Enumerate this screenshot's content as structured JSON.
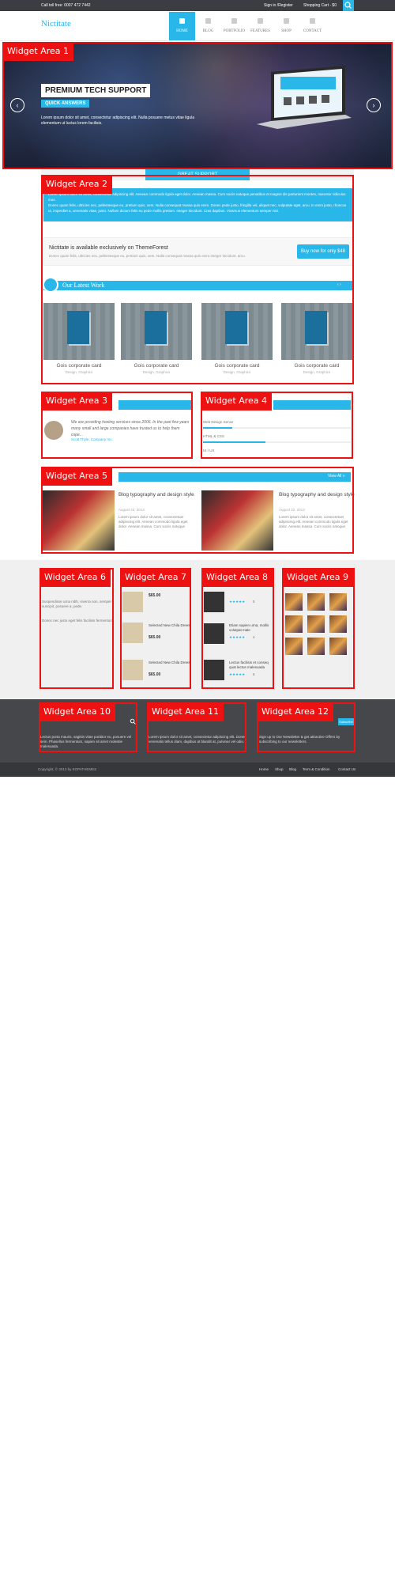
{
  "topbar": {
    "toll_free": "Call toll free: 0007 472 7442",
    "sign_in": "Sign in /Register",
    "cart": "Shopping Cart - $0"
  },
  "header": {
    "logo": "Nictitate",
    "nav": [
      "HOME",
      "BLOG",
      "PORTFOLIO",
      "FEATURES",
      "SHOP",
      "CONTACT"
    ]
  },
  "widgets": [
    "Widget Area 1",
    "Widget Area 2",
    "Widget Area 3",
    "Widget Area 4",
    "Widget Area 5",
    "Widget Area 6",
    "Widget Area 7",
    "Widget Area 8",
    "Widget Area 9",
    "Widget Area 10",
    "Widget Area 11",
    "Widget Area 12"
  ],
  "slider": {
    "title": "PREMIUM TECH SUPPORT",
    "subtitle": "QUICK ANSWERS",
    "text": "Lorem ipsum dolor sit amet, consectetur adipiscing elit. Nulla posuere metus vitae ligula elementum ut luctus lorem facilisis."
  },
  "feature_tab": "GREAT SUPPORT",
  "blue_panel": {
    "text1": "Lorem ipsum dolor sit amet, consectetur adipiscing elit. Aenean commodo ligula eget dolor. Aenean massa. Cum sociis natoque penatibus et magnis dis parturient montes, nascetur ridiculus mus.",
    "text2": "Donec quam felis, ultricies nec, pellentesque eu, pretium quis, sem. Nulla consequat massa quis enim. Donec pede justo, fringilla vel, aliquet nec, vulputate eget, arcu. In enim justo, rhoncus ut, imperdiet a, venenatis vitae, justo. Nullam dictum felis eu pede mollis pretium. Integer tincidunt. Cras dapibus. Vivamus elementum semper nisi."
  },
  "promo": {
    "title": "Nictitate is available exclusively on ThemeForest",
    "text": "Donec quam felis, ultricies nec, pellentesque eu, pretium quis, sem. Nulla consequat massa quis enim.Integer tincidunt. arcu.",
    "button": "Buy now for only $48"
  },
  "latest_work": {
    "title": "Our Latest Work",
    "cards": [
      {
        "title": "Gois corporate card",
        "category": "Design, Graphics"
      },
      {
        "title": "Gois corporate card",
        "category": "Design, Graphics"
      },
      {
        "title": "Gois corporate card",
        "category": "Design, Graphics"
      },
      {
        "title": "Gois corporate card",
        "category": "Design, Graphics"
      }
    ]
  },
  "testimonial": {
    "quote": "We are providing hosting services since 2006. In the past few years many small and large companies have trusted us to help them cope...",
    "author": "Scott Thyle, Company Inc."
  },
  "skills": [
    {
      "label": "Web Design Sense",
      "value": 0.2
    },
    {
      "label": "HTML & CSS",
      "value": 0.42
    },
    {
      "label": "UI / UX",
      "value": 0.5
    }
  ],
  "blog": {
    "view_all": "View All »",
    "posts": [
      {
        "title": "Blog typography and design style",
        "date": "August 22, 2013",
        "text": "Lorem ipsum dolor sit amet, consectetuer adipiscing elit. Aenean commodo ligula eget dolor. Aenean massa. Cum sociis natoque"
      },
      {
        "title": "Blog typography and design style",
        "date": "August 22, 2013",
        "text": "Lorem ipsum dolor sit amet, consectetuer adipiscing elit. Aenean commodo ligula eget dolor. Aenean massa. Cum sociis natoque"
      }
    ]
  },
  "col6": {
    "text1": "Suspendisse urna nibh, viverra non, semper suscipit, posuere a, pede.",
    "text2": "Donec nec justo eget felis facilisis fermentum."
  },
  "products": [
    {
      "name": "",
      "price": "$65.00"
    },
    {
      "name": "Selected New Chila Drees",
      "price": "$65.00"
    },
    {
      "name": "Selected New Chila Drees",
      "price": "$65.00"
    }
  ],
  "reviews": [
    {
      "name": "",
      "stars": "★★★★★",
      "count": "5"
    },
    {
      "name": "Etiam sapien urna, mollis volutpat male",
      "stars": "★★★★★",
      "count": "4"
    },
    {
      "name": "Lectus facilisis et conseq quat lectus malesuada",
      "stars": "★★★★★",
      "count": "6"
    }
  ],
  "footer": {
    "text10": "Lectus porta mauris, sagittis vitae porttitor eu, posuere vel sem. Phasellus fermentum, sapien sit amet molestie malesuada.",
    "text11": "Lorem ipsum dolor sit amet, consectetur adipiscing elit. Donec venenatis tellus diam, dapibus at blandit at, pulvinar vel odio.",
    "text12": "Sign up to Our Newsletter & get attractive Offers by subscribing to our newsletters.",
    "subscribe": "Subscribe",
    "copyright": "Copyright, © 2013 by KOPATHEMES",
    "links": [
      "Home",
      "Shop",
      "Blog",
      "Term & Condition",
      "Contact Us"
    ]
  },
  "colors": {
    "accent": "#29b6e8",
    "widget_red": "#ee1111",
    "footer_dark": "#45474b"
  }
}
